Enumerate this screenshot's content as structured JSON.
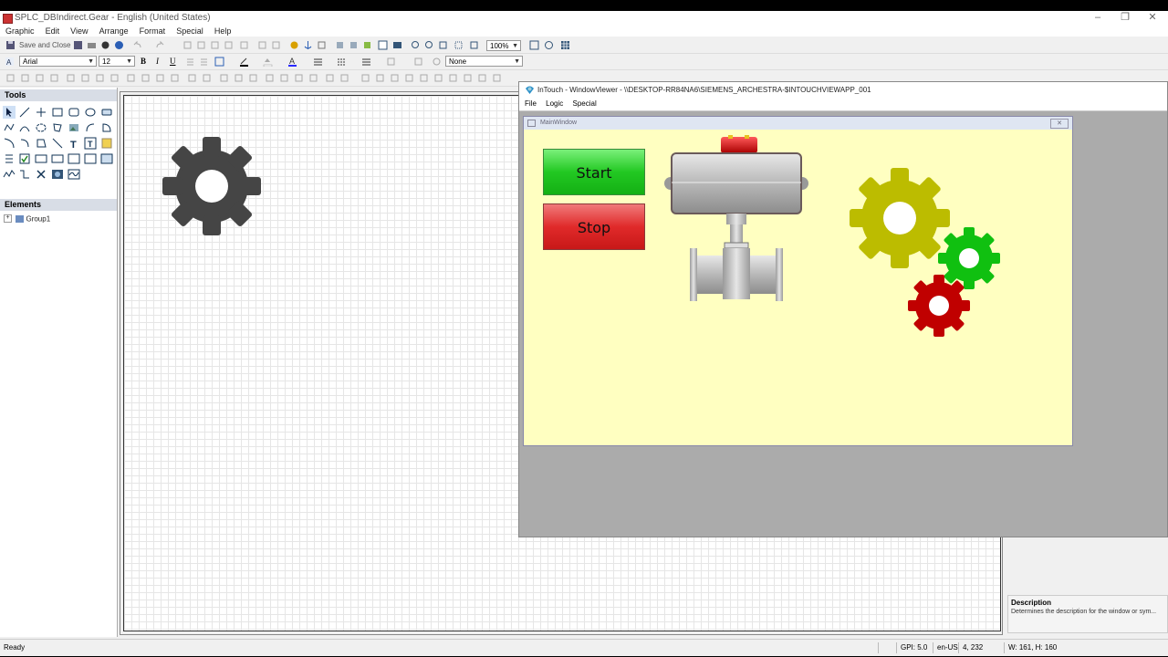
{
  "app": {
    "title": "SPLC_DBIndirect.Gear - English (United States)",
    "menu": [
      "Graphic",
      "Edit",
      "View",
      "Arrange",
      "Format",
      "Special",
      "Help"
    ]
  },
  "toolbar": {
    "save_close_label": "Save and Close",
    "zoom": "100%",
    "font_name": "Arial",
    "font_size": "12",
    "bold": "B",
    "italic": "I",
    "underline": "U",
    "fill_style": "None"
  },
  "tools_panel": {
    "title": "Tools"
  },
  "elements_panel": {
    "title": "Elements",
    "tree": [
      {
        "label": "Group1"
      }
    ]
  },
  "description_panel": {
    "title": "Description",
    "text": "Determines the description for the window or sym..."
  },
  "statusbar": {
    "status": "Ready",
    "gpi": "GPI: 5.0",
    "locale": "en-US",
    "coords": "4, 232",
    "size": "W: 161, H: 160"
  },
  "window_viewer": {
    "title": "InTouch - WindowViewer - \\\\DESKTOP-RR84NA6\\SIEMENS_ARCHESTRA-$INTOUCHVIEWAPP_001",
    "menu": [
      "File",
      "Logic",
      "Special"
    ],
    "main_window": {
      "title": "MainWindow",
      "start_label": "Start",
      "stop_label": "Stop"
    }
  },
  "colors": {
    "canvas_gear": "#454545",
    "start_button": "#2fd42f",
    "stop_button": "#e02a2a",
    "main_window_bg": "#ffffc1",
    "gear_yellow": "#bcbc00",
    "gear_green": "#10c010",
    "gear_red": "#c00000"
  },
  "icons": [
    "gear-icon",
    "valve-icon"
  ]
}
